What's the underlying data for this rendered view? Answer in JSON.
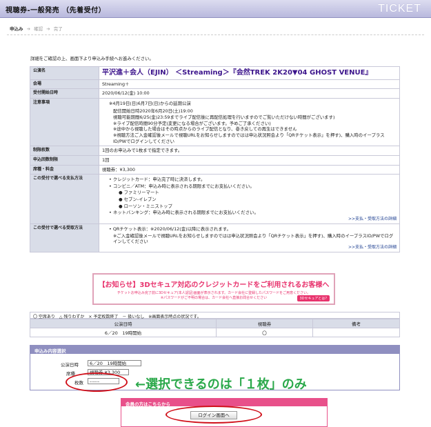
{
  "header": {
    "title": "視聴券-一般発売 （先着受付）",
    "logo": "TICKET"
  },
  "steps": [
    "申込み",
    "確認",
    "完了"
  ],
  "intro": "詳細をご確認の上、画面下より申込み手続へお進みください。",
  "info_rows": {
    "event_name_label": "公演名",
    "event_name": "平沢進＋会人（EJIN） ＜Streaming＞『会然TREK 2K20▼04 GHOST VENUE』",
    "venue_label": "会場",
    "venue": "Streaming＋",
    "start_label": "受付開始日時",
    "start": "2020/06/12(金) 10:00",
    "notes_label": "注意事項",
    "notes": [
      "※4月19日(日)6月7日(日)からの延期公演",
      "配信開始日時2020年6月20日(土)19:00",
      "視聴可能期間6/25(金)23:59までライブ配信後に再配信処理を行いますのでご覧いただけない時間がございます)",
      "※ライブ配信時間90分予定(変更になる場合がございます。予めご了承ください)",
      "※途中から視聴した場合はその時点からのライブ配信となり、巻き戻しての再生はできません",
      "※視聴方法ご入金確認後メールで視聴URLをお知らせしますのではは申込状況照会より「QRチケット表示」を押す)、購入時のイープラスID/PWでログインしてください"
    ],
    "limit_label": "制限枚数",
    "limit": "1回のお申込みで1枚まで指定できます。",
    "count_label": "申込回数制限",
    "count": "1回",
    "price_label": "席種・料金",
    "price": "視聴券：¥3,300",
    "payment_label": "この受付で選べる支払方法",
    "payment": {
      "credit": "クレジットカード：申込完了時に決済します。",
      "convenience": "コンビニ／ATM：申込み時に表示される期限までにお支払いください。",
      "stores": [
        "ファミリーマート",
        "セブン-イレブン",
        "ローソン・ミニストップ"
      ],
      "netbank": "ネットバンキング：申込み時に表示される期限までにお支払いください。",
      "link": ">>支払・受取方法の詳細"
    },
    "receive_label": "この受付で選べる受取方法",
    "receive": {
      "qr": "QRチケット表示：※2020/06/12(金)以降に表示されます。",
      "qr_detail": "※ご入金確認後メールで視聴URLをお知らせしますのではは申込状況照会より「QRチケット表示」を押す)、購入時のイープラスID/PWでログインしてください",
      "link": ">>支払・受取方法の詳細"
    }
  },
  "banner": {
    "title": "【お知らせ】3Dセキュア対応のクレジットカードをご利用されるお客様へ",
    "line1": "チケットお申込み完了前に3Dセキュア(本人認証)画面が表示されます。カード会社に登録したパスワードをご用意ください。",
    "line2": "※パスワードがご不明の場合は、カード会社へ直接お問合せください",
    "button": "3Dセキュアとは?"
  },
  "legend": "〇 空席あり　△ 残りわずか　× 予定枚数終了　－ 扱いなし　※画面表示時点の状況です。",
  "availability": {
    "headers": [
      "公演日時",
      "視聴券",
      "備考"
    ],
    "rows": [
      [
        "6／20　19時開始",
        "〇",
        ""
      ]
    ]
  },
  "selection": {
    "header": "申込み内容選択",
    "date_label": "公演日時",
    "date_value": "6／20　19時開始",
    "seat_label": "席種",
    "seat_value": "視聴券 ¥3,300",
    "qty_label": "枚数",
    "qty_value": "------"
  },
  "annotation": "←選択できるのは「１枚」のみ",
  "login": {
    "header": "会員の方はこちらから",
    "button": "ログイン画面へ"
  },
  "colors": {
    "accent": "#3c148c",
    "annotation": "#2aa84a",
    "circle": "#d0101a",
    "pink": "#e8336d"
  }
}
